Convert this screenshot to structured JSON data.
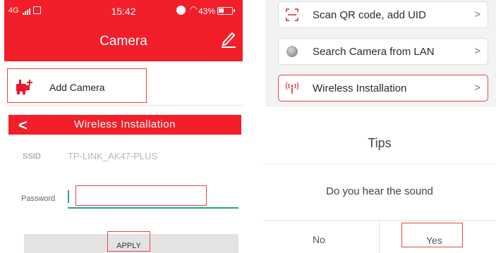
{
  "camera_panel": {
    "status_bar": {
      "network": "4G",
      "time": "15:42",
      "battery_pct": "43%"
    },
    "title": "Camera",
    "add_camera_label": "Add Camera"
  },
  "add_menu": {
    "items": [
      {
        "label": "Scan QR code, add UID",
        "icon": "qr-scan-icon"
      },
      {
        "label": "Search Camera from LAN",
        "icon": "lan-search-icon"
      },
      {
        "label": "Wireless Installation",
        "icon": "wireless-antenna-icon"
      }
    ],
    "chevron": ">"
  },
  "wireless_panel": {
    "back_glyph": "<",
    "title": "Wireless Installation",
    "ssid_label": "SSID",
    "ssid_value": "TP-LINK_AK47-PLUS",
    "password_label": "Password",
    "password_value": "",
    "apply_label": "APPLY"
  },
  "tips_dialog": {
    "title": "Tips",
    "message": "Do you hear the sound",
    "no_label": "No",
    "yes_label": "Yes"
  },
  "colors": {
    "accent_red": "#f21e2a",
    "highlight_box": "#e64646",
    "input_teal": "#21a78c"
  },
  "battery_level": 0.43
}
